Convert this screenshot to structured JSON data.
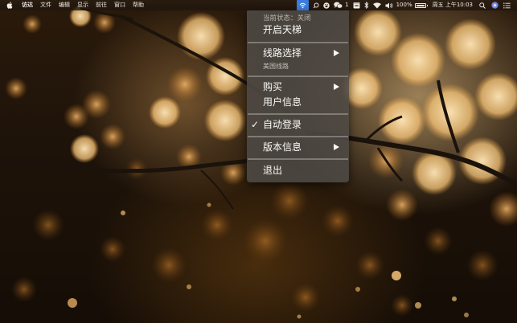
{
  "menubar": {
    "apple_icon": "apple-logo-icon",
    "menus": [
      "访达",
      "文件",
      "编辑",
      "显示",
      "前往",
      "窗口",
      "帮助"
    ],
    "status": {
      "vpn_icon": "wifi-shield-icon",
      "search_icon": "search-icon",
      "baidu_icon": "baidu-paw-icon",
      "wechat_icon": "wechat-icon",
      "wechat_count": "1",
      "calendar_icon": "calendar-icon",
      "bluetooth_icon": "bluetooth-icon",
      "wifi_icon": "wifi-icon",
      "volume_icon": "volume-icon",
      "battery": "100%",
      "battery_level_percent": 100,
      "clock": "周五 上午10:03",
      "spotlight_icon": "spotlight-search-icon",
      "siri_icon": "siri-icon",
      "notification_icon": "notification-center-icon"
    }
  },
  "menu": {
    "status_label": "当前状态：关闭",
    "toggle": "开启天梯",
    "route_select": "线路选择",
    "route_current": "美国线路",
    "buy": "购买",
    "user_info": "用户信息",
    "auto_login": "自动登录",
    "auto_login_check": "✓",
    "version_info": "版本信息",
    "quit": "退出"
  }
}
